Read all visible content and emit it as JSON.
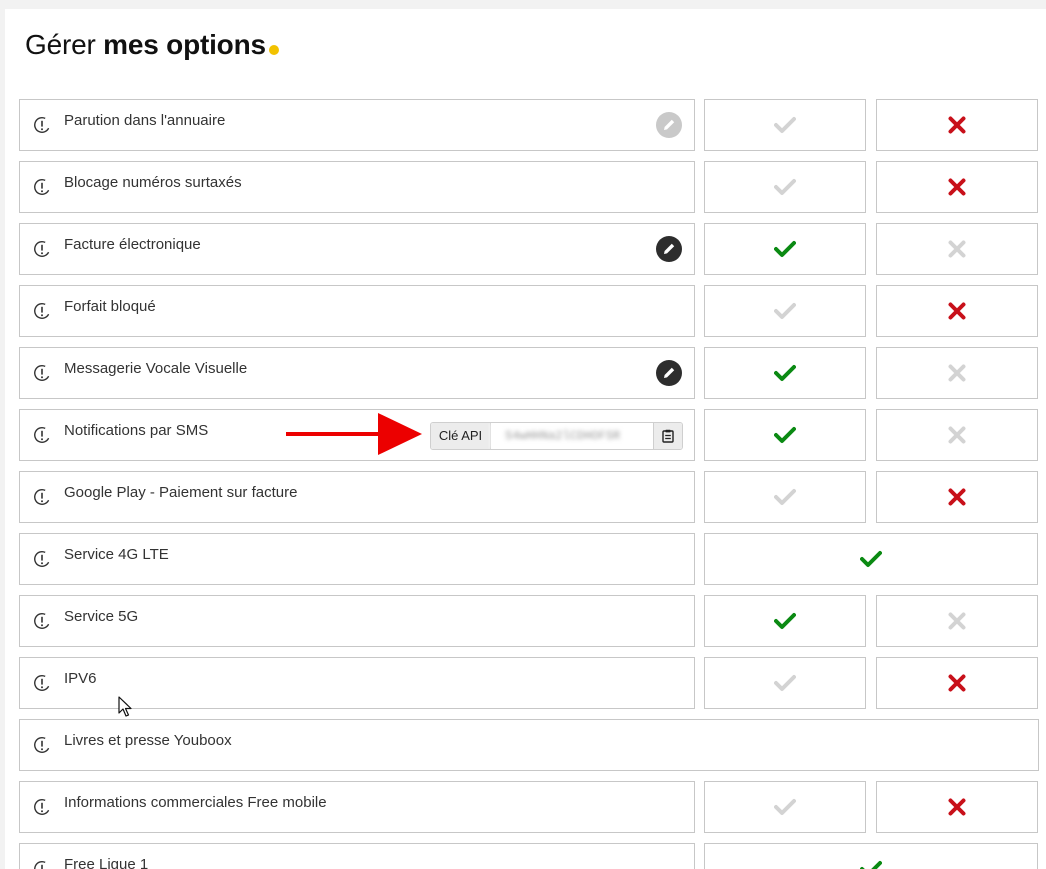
{
  "page": {
    "title_light": "Gérer ",
    "title_bold": "mes options",
    "accent_color": "#f2c200"
  },
  "colors": {
    "check_active": "#0b8a13",
    "cross_active": "#c8101a",
    "inactive": "#d3d3d3"
  },
  "options": [
    {
      "label": "Parution dans l'annuaire",
      "edit": "disabled",
      "state": "off",
      "cells": "two"
    },
    {
      "label": "Blocage numéros surtaxés",
      "edit": "none",
      "state": "off",
      "cells": "two"
    },
    {
      "label": "Facture électronique",
      "edit": "enabled",
      "state": "on",
      "cells": "two"
    },
    {
      "label": "Forfait bloqué",
      "edit": "none",
      "state": "off",
      "cells": "two"
    },
    {
      "label": "Messagerie Vocale Visuelle",
      "edit": "enabled",
      "state": "on",
      "cells": "two"
    },
    {
      "label": "Notifications par SMS",
      "edit": "api",
      "state": "on",
      "cells": "two",
      "api_label": "Clé API",
      "api_key": "S4wHHNa2lCDHOFSR",
      "copy_icon": "clipboard-icon"
    },
    {
      "label": "Google Play - Paiement sur facture",
      "edit": "none",
      "state": "off",
      "cells": "two"
    },
    {
      "label": "Service 4G LTE",
      "edit": "none",
      "state": "on",
      "cells": "one"
    },
    {
      "label": "Service 5G",
      "edit": "none",
      "state": "on",
      "cells": "two"
    },
    {
      "label": "IPV6",
      "edit": "none",
      "state": "off",
      "cells": "two"
    },
    {
      "label": "Livres et presse Youboox",
      "edit": "none",
      "state": "none",
      "cells": "none"
    },
    {
      "label": "Informations commerciales Free mobile",
      "edit": "none",
      "state": "off",
      "cells": "two"
    },
    {
      "label": "Free Ligue 1",
      "edit": "none",
      "state": "on",
      "cells": "one"
    }
  ]
}
